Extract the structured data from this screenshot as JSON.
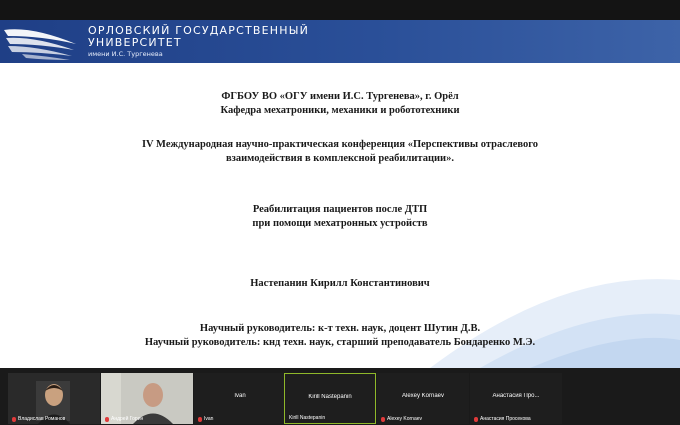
{
  "university": {
    "line1": "ОРЛОВСКИЙ ГОСУДАРСТВЕННЫЙ",
    "line2": "УНИВЕРСИТЕТ",
    "sub": "имени И.С. Тургенева"
  },
  "slide": {
    "org": "ФГБОУ ВО «ОГУ имени И.С. Тургенева», г. Орёл",
    "department": "Кафедра мехатроники, механики и робототехники",
    "conference_line1": "IV Международная научно-практическая конференция «Перспективы отраслевого",
    "conference_line2": "взаимодействия в комплексной реабилитации».",
    "title_line1": "Реабилитация пациентов после ДТП",
    "title_line2": "при помощи мехатронных устройств",
    "author": "Настепанин Кирилл Константинович",
    "supervisor1": "Научный руководитель: к-т техн. наук, доцент Шутин Д.В.",
    "supervisor2": "Научный руководитель: кнд техн. наук, старший преподаватель Бондаренко М.Э."
  },
  "participants": [
    {
      "label": "Владислав Романов",
      "center": ""
    },
    {
      "label": "Андрей Горин",
      "center": ""
    },
    {
      "label": "Ivan",
      "center": "Ivan"
    },
    {
      "label": "Kirill Nastepanin",
      "center": "Kirill Nastepanin"
    },
    {
      "label": "Alexey Kornaev",
      "center": "Alexey Kornaev"
    },
    {
      "label": "Анастасия Просекова",
      "center": "Анастасия  Про..."
    }
  ],
  "colors": {
    "banner": "#2a4f98",
    "active_border": "#8fb82a",
    "mic_muted": "#e03a3a"
  },
  "icons": {
    "university_logo": "eagle-wing-logo-icon",
    "mic_muted": "mic-muted-icon"
  }
}
